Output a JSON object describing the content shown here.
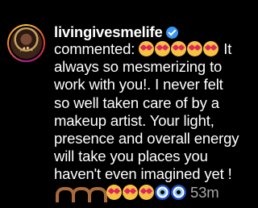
{
  "notification": {
    "username": "livingivesmelife",
    "verified_icon": "verified-badge-icon",
    "action": "commented:",
    "comment_text": "It always so mesmerizing to work with you!. I never felt so well taken care of by a makeup artist. Your light, presence and overall energy will take you places you haven't even imagined yet !",
    "time": "53m",
    "leading_emojis": [
      "heart-eyes-emoji",
      "heart-eyes-emoji",
      "heart-eyes-emoji",
      "heart-eyes-emoji",
      "heart-eyes-emoji"
    ],
    "trailing_emojis": [
      "heart-hands-emoji",
      "heart-hands-emoji",
      "heart-hands-emoji",
      "heart-eyes-emoji",
      "heart-eyes-emoji",
      "heart-eyes-emoji",
      "evil-eye-emoji",
      "evil-eye-emoji"
    ]
  },
  "colors": {
    "background": "#000000",
    "text": "#ffffff",
    "muted": "#a8a8a8",
    "verified": "#3897f0"
  }
}
